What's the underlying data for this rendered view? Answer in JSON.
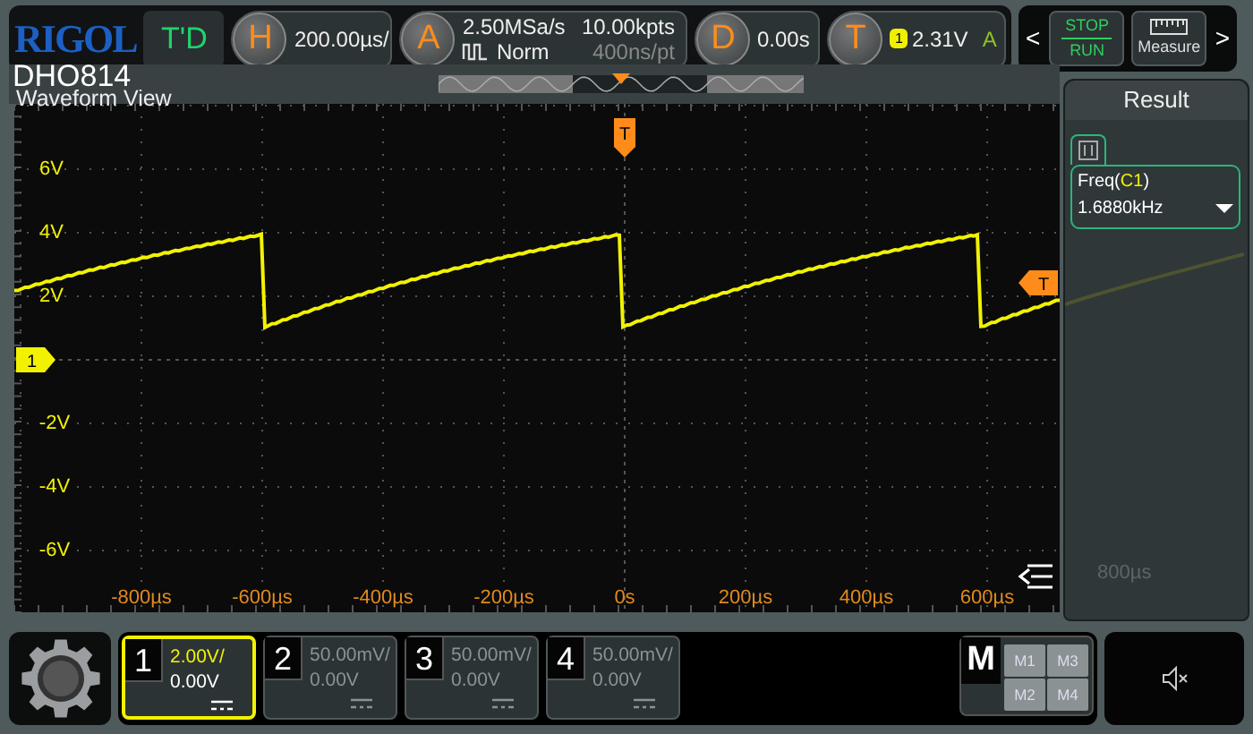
{
  "header": {
    "logo": "RIGOL",
    "model": "DHO814",
    "run_status": "T'D",
    "horizontal": {
      "key": "H",
      "scale": "200.00µs/"
    },
    "acquire": {
      "key": "A",
      "sample_rate": "2.50MSa/s",
      "mode": "Norm",
      "memory_depth": "10.00kpts",
      "sample_interval": "400ns/pt"
    },
    "delay": {
      "key": "D",
      "offset": "0.00s"
    },
    "trigger": {
      "key": "T",
      "source": "1",
      "level": "2.31V",
      "sweep": "A"
    },
    "prev": "<",
    "stop_run": {
      "stop": "STOP",
      "run": "RUN"
    },
    "measure": "Measure",
    "next": ">"
  },
  "waveform_view": {
    "title": "Waveform View",
    "channel_marker": "1",
    "trigger_position_marker": "T",
    "trigger_level_marker": "T",
    "y_labels": [
      "6V",
      "4V",
      "2V",
      "-2V",
      "-4V",
      "-6V"
    ],
    "x_labels": [
      "-800µs",
      "-600µs",
      "-400µs",
      "-200µs",
      "0s",
      "200µs",
      "400µs",
      "600µs"
    ]
  },
  "result": {
    "title": "Result",
    "measurements": [
      {
        "prefix": "Freq(",
        "source": "C1",
        "suffix": ")",
        "value": "1.6880kHz"
      }
    ],
    "x_label": "800µs"
  },
  "channels": [
    {
      "number": "1",
      "scale": "2.00V/",
      "offset": "0.00V",
      "enabled": true,
      "selected": true
    },
    {
      "number": "2",
      "scale": "50.00mV/",
      "offset": "0.00V",
      "enabled": false,
      "selected": false
    },
    {
      "number": "3",
      "scale": "50.00mV/",
      "offset": "0.00V",
      "enabled": false,
      "selected": false
    },
    {
      "number": "4",
      "scale": "50.00mV/",
      "offset": "0.00V",
      "enabled": false,
      "selected": false
    }
  ],
  "math": {
    "key": "M",
    "items": [
      "M1",
      "M3",
      "M2",
      "M4"
    ]
  }
}
